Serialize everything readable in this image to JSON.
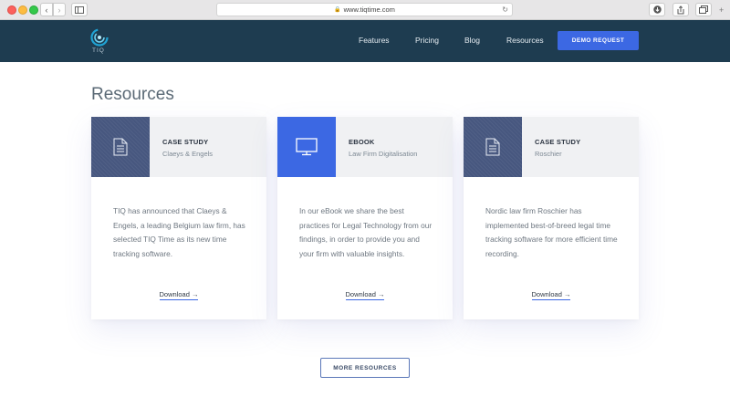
{
  "browser": {
    "url": "www.tiqtime.com",
    "lock_icon": "lock-icon",
    "reload_icon": "reload-icon"
  },
  "header": {
    "logo_text": "TIQ",
    "nav": [
      "Features",
      "Pricing",
      "Blog",
      "Resources"
    ],
    "demo_label": "DEMO REQUEST",
    "accent_color": "#3c68e3",
    "bg_color": "#1e3c50"
  },
  "page": {
    "title": "Resources"
  },
  "cards": [
    {
      "icon": "document-icon",
      "type": "CASE STUDY",
      "subtitle": "Claeys & Engels",
      "text": "TIQ has announced that Claeys & Engels, a leading Belgium law firm, has selected TIQ Time as its new time tracking software.",
      "link": "Download →"
    },
    {
      "icon": "monitor-icon",
      "type": "EBOOK",
      "subtitle": "Law Firm Digitalisation",
      "text": "In our eBook we share the best practices for Legal Technology from our findings, in order to provide you and your firm with valuable insights.",
      "link": "Download →"
    },
    {
      "icon": "document-icon",
      "type": "CASE STUDY",
      "subtitle": "Roschier",
      "text": "Nordic law firm Roschier has implemented best-of-breed legal time tracking software for more efficient time recording.",
      "link": "Download →"
    }
  ],
  "more_label": "MORE RESOURCES"
}
